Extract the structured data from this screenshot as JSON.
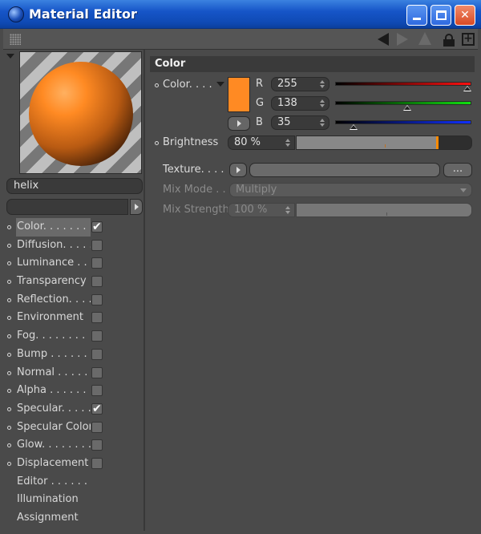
{
  "window": {
    "title": "Material Editor",
    "min_label": "",
    "max_label": "",
    "close_label": "✕"
  },
  "toolbar": {
    "new_window_label": "+"
  },
  "material": {
    "name": "helix",
    "preview_color": "#ff8a23"
  },
  "channels": [
    {
      "label": "Color. . . . . . .",
      "checked": true,
      "active": true
    },
    {
      "label": "Diffusion. . . . .",
      "checked": false
    },
    {
      "label": "Luminance . . .",
      "checked": false
    },
    {
      "label": "Transparency",
      "checked": false
    },
    {
      "label": "Reflection. . . .",
      "checked": false
    },
    {
      "label": "Environment",
      "checked": false
    },
    {
      "label": "Fog. . . . . . . .",
      "checked": false
    },
    {
      "label": "Bump . . . . . . .",
      "checked": false
    },
    {
      "label": "Normal . . . . . .",
      "checked": false
    },
    {
      "label": "Alpha . . . . . . .",
      "checked": false
    },
    {
      "label": "Specular. . . . .",
      "checked": true
    },
    {
      "label": "Specular Color",
      "checked": false
    },
    {
      "label": "Glow. . . . . . . .",
      "checked": false
    },
    {
      "label": "Displacement",
      "checked": false
    },
    {
      "label": "Editor . . . . . . .",
      "checkbox": false
    },
    {
      "label": "Illumination",
      "checkbox": false
    },
    {
      "label": "Assignment",
      "checkbox": false
    }
  ],
  "color_section": {
    "header": "Color",
    "color_label": "Color. . . .",
    "swatch": "#ff8a23",
    "r": {
      "label": "R",
      "value": "255",
      "fraction": 1.0
    },
    "g": {
      "label": "G",
      "value": "138",
      "fraction": 0.541
    },
    "b": {
      "label": "B",
      "value": "35",
      "fraction": 0.137
    },
    "brightness_label": "Brightness",
    "brightness_value": "80 %",
    "brightness_fraction": 0.8,
    "texture_label": "Texture. . . .",
    "texture_more": "...",
    "mix_mode_label": "Mix Mode . .",
    "mix_mode_value": "Multiply",
    "mix_strength_label": "Mix Strength",
    "mix_strength_value": "100 %",
    "mix_strength_fraction": 1.0
  }
}
